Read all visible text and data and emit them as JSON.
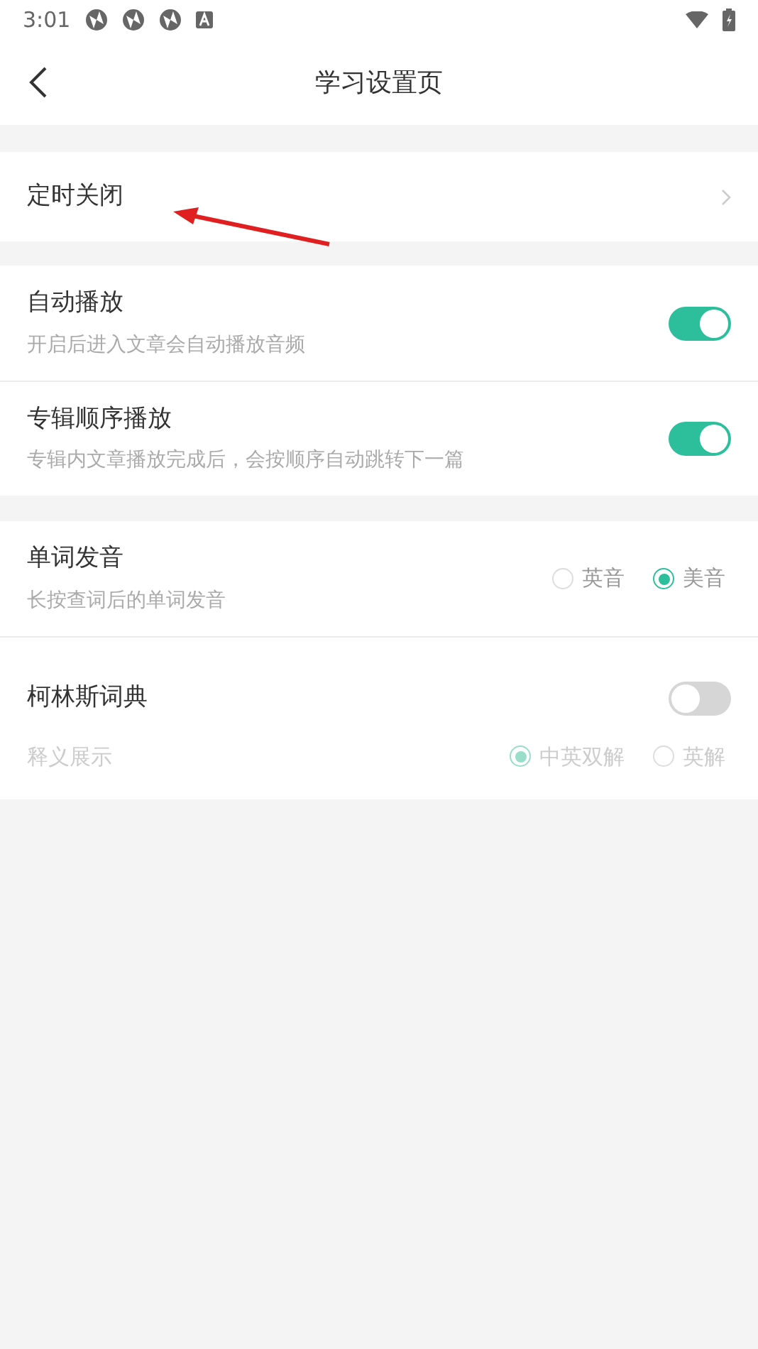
{
  "status_bar": {
    "time": "3:01"
  },
  "header": {
    "title": "学习设置页"
  },
  "timer_row": {
    "label": "定时关闭"
  },
  "play_settings": [
    {
      "title": "自动播放",
      "subtitle": "开启后进入文章会自动播放音频",
      "on": true
    },
    {
      "title": "专辑顺序播放",
      "subtitle": "专辑内文章播放完成后，会按顺序自动跳转下一篇",
      "on": true
    }
  ],
  "pronunciation": {
    "title": "单词发音",
    "subtitle": "长按查词后的单词发音",
    "options": [
      {
        "label": "英音",
        "selected": false
      },
      {
        "label": "美音",
        "selected": true
      }
    ]
  },
  "collins": {
    "title": "柯林斯词典",
    "on": false,
    "sub_label": "释义展示",
    "disabled": true,
    "options": [
      {
        "label": "中英双解",
        "selected": true
      },
      {
        "label": "英解",
        "selected": false
      }
    ]
  }
}
